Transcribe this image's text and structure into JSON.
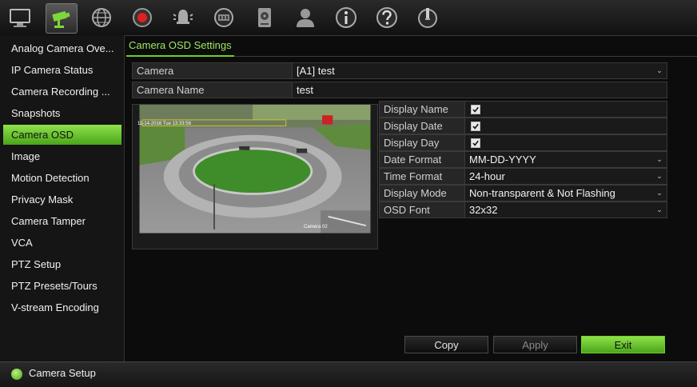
{
  "topbar": {
    "icons": [
      {
        "name": "monitor-icon"
      },
      {
        "name": "camera-icon"
      },
      {
        "name": "network-icon"
      },
      {
        "name": "record-icon"
      },
      {
        "name": "alarm-icon"
      },
      {
        "name": "device-icon"
      },
      {
        "name": "hdd-icon"
      },
      {
        "name": "user-icon"
      },
      {
        "name": "info-icon"
      },
      {
        "name": "help-icon"
      },
      {
        "name": "power-icon"
      }
    ],
    "active_index": 1
  },
  "sidebar": {
    "items": [
      {
        "label": "Analog Camera Ove..."
      },
      {
        "label": "IP Camera Status"
      },
      {
        "label": "Camera Recording ..."
      },
      {
        "label": "Snapshots"
      },
      {
        "label": "Camera OSD"
      },
      {
        "label": "Image"
      },
      {
        "label": "Motion Detection"
      },
      {
        "label": "Privacy Mask"
      },
      {
        "label": "Camera Tamper"
      },
      {
        "label": "VCA"
      },
      {
        "label": "PTZ Setup"
      },
      {
        "label": "PTZ Presets/Tours"
      },
      {
        "label": "V-stream Encoding"
      }
    ],
    "active_index": 4
  },
  "tab": {
    "label": "Camera OSD Settings"
  },
  "camera": {
    "label": "Camera",
    "value": "[A1] test"
  },
  "camera_name": {
    "label": "Camera Name",
    "value": "test"
  },
  "osd": {
    "display_name": {
      "label": "Display Name",
      "checked": true
    },
    "display_date": {
      "label": "Display Date",
      "checked": true
    },
    "display_day": {
      "label": "Display Day",
      "checked": true
    },
    "date_format": {
      "label": "Date Format",
      "value": "MM-DD-YYYY"
    },
    "time_format": {
      "label": "Time Format",
      "value": "24-hour"
    },
    "display_mode": {
      "label": "Display Mode",
      "value": "Non-transparent & Not Flashing"
    },
    "osd_font": {
      "label": "OSD Font",
      "value": "32x32"
    }
  },
  "preview": {
    "timestamp_overlay": "11-14-2016 Tue 13:33:56",
    "camera_label_overlay": "Camera 02"
  },
  "buttons": {
    "copy": "Copy",
    "apply": "Apply",
    "exit": "Exit"
  },
  "status": {
    "text": "Camera Setup"
  },
  "colors": {
    "accent": "#6ecf2a",
    "background": "#0c0c0c"
  }
}
